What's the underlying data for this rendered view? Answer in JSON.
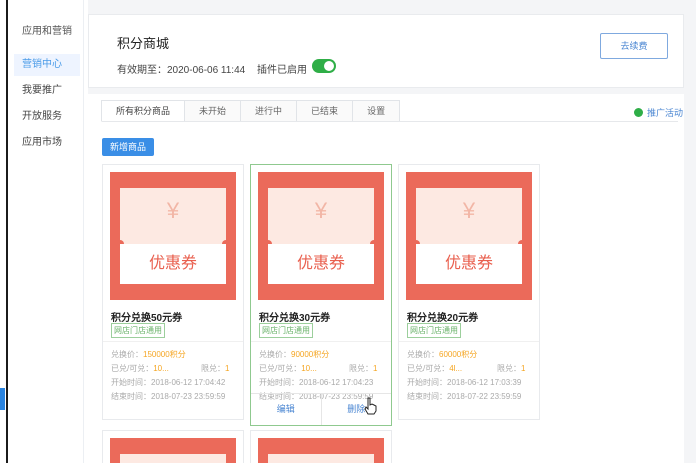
{
  "sidebar": {
    "title": "应用和营销",
    "items": [
      {
        "label": "营销中心",
        "active": true
      },
      {
        "label": "我要推广",
        "active": false
      },
      {
        "label": "开放服务",
        "active": false
      },
      {
        "label": "应用市场",
        "active": false
      }
    ]
  },
  "header": {
    "title": "积分商城",
    "validity": "有效期至：2020-06-06 11:44",
    "plugin_status": "插件已启用",
    "toggle_on": true,
    "cta_label": "去续费"
  },
  "tabs": [
    "所有积分商品",
    "未开始",
    "进行中",
    "已结束",
    "设置"
  ],
  "promo_link": "推广活动",
  "add_button": "新增商品",
  "coupon_text": "优惠券",
  "yen_symbol": "¥",
  "cards": [
    {
      "name": "积分兑换50元券",
      "store_tag": "网店门店通用",
      "price_label": "兑换价：",
      "price_value": "150000积分",
      "exchanged_label": "已兑/可兑：",
      "exchanged_value": "10...",
      "limit_label": "限兑：",
      "limit_value": "1",
      "start_label": "开始时间：",
      "start_value": "2018-06-12 17:04:42",
      "end_label": "结束时间：",
      "end_value": "2018-07-23 23:59:59"
    },
    {
      "name": "积分兑换30元券",
      "store_tag": "网店门店通用",
      "price_label": "兑换价：",
      "price_value": "90000积分",
      "exchanged_label": "已兑/可兑：",
      "exchanged_value": "10...",
      "limit_label": "限兑：",
      "limit_value": "1",
      "start_label": "开始时间：",
      "start_value": "2018-06-12 17:04:23",
      "end_label": "结束时间：",
      "end_value": "2018-07-23 23:59:59",
      "actions": [
        "编辑",
        "删除"
      ]
    },
    {
      "name": "积分兑换20元券",
      "store_tag": "网店门店通用",
      "price_label": "兑换价：",
      "price_value": "60000积分",
      "exchanged_label": "已兑/可兑：",
      "exchanged_value": "4l...",
      "limit_label": "限兑：",
      "limit_value": "1",
      "start_label": "开始时间：",
      "start_value": "2018-06-12 17:03:39",
      "end_label": "结束时间：",
      "end_value": "2018-07-22 23:59:59"
    }
  ],
  "colors": {
    "accent_blue": "#3a8ee6",
    "toggle_green": "#2fae47",
    "coupon_red": "#eb6a5a",
    "points_orange": "#f5a623"
  }
}
